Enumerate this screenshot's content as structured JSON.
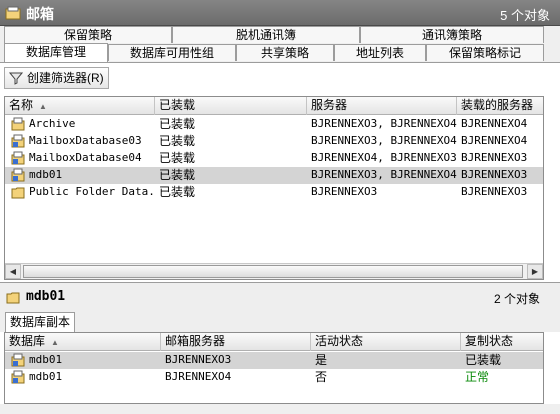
{
  "window": {
    "title": "邮箱",
    "object_count": "5 个对象"
  },
  "tabs_row1": [
    "保留策略",
    "脱机通讯簿",
    "通讯簿策略"
  ],
  "tabs_row2": [
    "数据库管理",
    "数据库可用性组",
    "共享策略",
    "地址列表",
    "保留策略标记"
  ],
  "toolbar": {
    "create_filter_label": "创建筛选器(R)"
  },
  "db_list": {
    "columns": [
      "名称",
      "已装载",
      "服务器",
      "装载的服务器"
    ],
    "rows": [
      {
        "name": "Archive",
        "mounted": "已装载",
        "servers": "BJRENNEXO3, BJRENNEXO4",
        "mounted_server": "BJRENNEXO4"
      },
      {
        "name": "MailboxDatabase03",
        "mounted": "已装载",
        "servers": "BJRENNEXO3, BJRENNEXO4",
        "mounted_server": "BJRENNEXO4"
      },
      {
        "name": "MailboxDatabase04",
        "mounted": "已装载",
        "servers": "BJRENNEXO4, BJRENNEXO3",
        "mounted_server": "BJRENNEXO3"
      },
      {
        "name": "mdb01",
        "mounted": "已装载",
        "servers": "BJRENNEXO3, BJRENNEXO4",
        "mounted_server": "BJRENNEXO3"
      },
      {
        "name": "Public Folder Data...",
        "mounted": "已装载",
        "servers": "BJRENNEXO3",
        "mounted_server": "BJRENNEXO3"
      }
    ]
  },
  "detail": {
    "name": "mdb01",
    "object_count": "2 个对象",
    "tab": "数据库副本"
  },
  "copy_list": {
    "columns": [
      "数据库",
      "邮箱服务器",
      "活动状态",
      "复制状态"
    ],
    "rows": [
      {
        "db": "mdb01",
        "server": "BJRENNEXO3",
        "active": "是",
        "copy_status": "已装载"
      },
      {
        "db": "mdb01",
        "server": "BJRENNEXO4",
        "active": "否",
        "copy_status": "正常"
      }
    ]
  },
  "colors": {
    "titlebar": "#707070",
    "selection": "#d4d4d4",
    "healthy": "#0a8a0a"
  },
  "icons": {
    "app": "mailbox-folder-icon",
    "db": "database-icon",
    "filter": "filter-icon"
  }
}
